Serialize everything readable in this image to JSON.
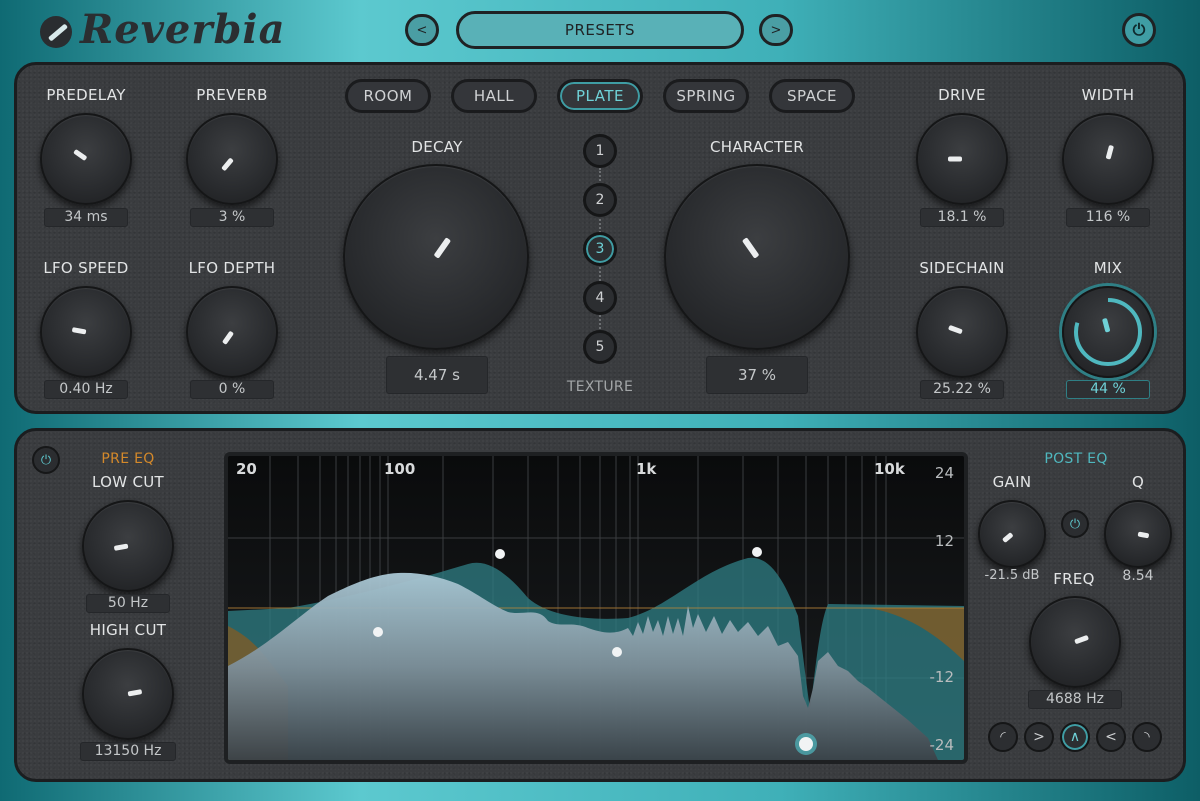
{
  "header": {
    "app_name": "Reverbia",
    "prev_label": "<",
    "next_label": ">",
    "presets_label": "PRESETS",
    "power_icon": "power-icon"
  },
  "reverb_types": [
    {
      "label": "ROOM",
      "active": false
    },
    {
      "label": "HALL",
      "active": false
    },
    {
      "label": "PLATE",
      "active": true
    },
    {
      "label": "SPRING",
      "active": false
    },
    {
      "label": "SPACE",
      "active": false
    }
  ],
  "texture": {
    "label": "TEXTURE",
    "steps": [
      "1",
      "2",
      "3",
      "4",
      "5"
    ],
    "selected": "3"
  },
  "knobs": {
    "predelay": {
      "label": "PREDELAY",
      "value": "34 ms"
    },
    "preverb": {
      "label": "PREVERB",
      "value": "3 %"
    },
    "lfo_speed": {
      "label": "LFO SPEED",
      "value": "0.40 Hz"
    },
    "lfo_depth": {
      "label": "LFO DEPTH",
      "value": "0 %"
    },
    "decay": {
      "label": "DECAY",
      "value": "4.47 s"
    },
    "character": {
      "label": "CHARACTER",
      "value": "37 %"
    },
    "drive": {
      "label": "DRIVE",
      "value": "18.1 %"
    },
    "width": {
      "label": "WIDTH",
      "value": "116 %"
    },
    "sidechain": {
      "label": "SIDECHAIN",
      "value": "25.22 %"
    },
    "mix": {
      "label": "MIX",
      "value": "44 %"
    }
  },
  "pre_eq": {
    "title": "PRE EQ",
    "low_cut": {
      "label": "LOW CUT",
      "value": "50 Hz"
    },
    "high_cut": {
      "label": "HIGH CUT",
      "value": "13150 Hz"
    }
  },
  "post_eq": {
    "title": "POST EQ",
    "gain": {
      "label": "GAIN",
      "value": "-21.5 dB"
    },
    "q": {
      "label": "Q",
      "value": "8.54"
    },
    "freq": {
      "label": "FREQ",
      "value": "4688 Hz"
    },
    "shapes": [
      "low-shelf-icon",
      "high-pass-icon",
      "bell-icon",
      "low-pass-icon",
      "high-shelf-icon"
    ],
    "active_shape": "bell-icon"
  },
  "eq_display": {
    "freq_labels": [
      "20",
      "100",
      "1k",
      "10k"
    ],
    "db_labels": [
      "24",
      "12",
      "-12",
      "-24"
    ]
  },
  "colors": {
    "accent": "#4fb8bf",
    "pre_eq_orange": "#d4892a",
    "post_eq_teal": "#4fb8bf"
  }
}
